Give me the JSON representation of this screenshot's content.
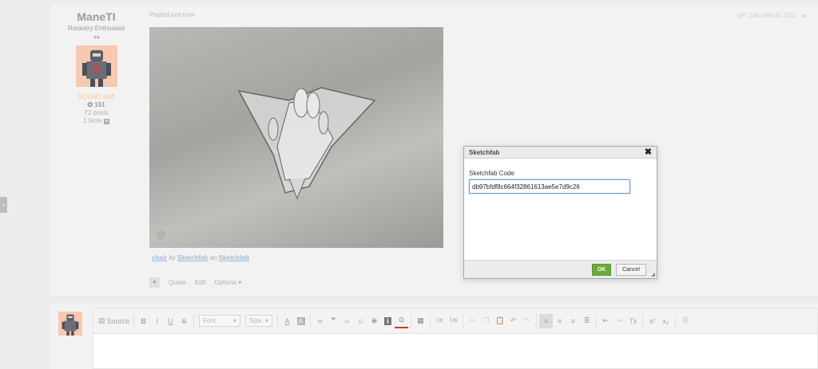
{
  "sidebar": {
    "expand_glyph": "›"
  },
  "author": {
    "name": "ManeTI",
    "title": "Rocketry Enthusiast",
    "pips": "●●",
    "group": "SQUAD staff",
    "reputation": "151",
    "posts": "72 posts",
    "notes": "1 Note"
  },
  "post": {
    "posted": "Posted just now",
    "meta": "(IP: 146.088.00.124)",
    "embed_caption": {
      "model": "chair",
      "by": " by ",
      "author": "Sketchfab",
      "on": " on ",
      "site": "Sketchfab"
    },
    "actions": {
      "plus": "+",
      "quote": "Quote",
      "edit": "Edit",
      "options": "Options ▾"
    }
  },
  "editor": {
    "source_label": "Source",
    "font_select": "Font",
    "size_select": "Size"
  },
  "dialog": {
    "title": "Sketchfab",
    "close": "✖",
    "field_label": "Sketchfab Code",
    "field_value": "db97bfdf8c664f32861613ae5e7d9c26",
    "ok_label": "OK",
    "cancel_label": "Cancel"
  },
  "colors": {
    "accent_green": "#6aab3a",
    "focus_blue": "#6a9bd1",
    "link_blue": "#9fb9d6",
    "staff_orange": "#f4c89e"
  }
}
